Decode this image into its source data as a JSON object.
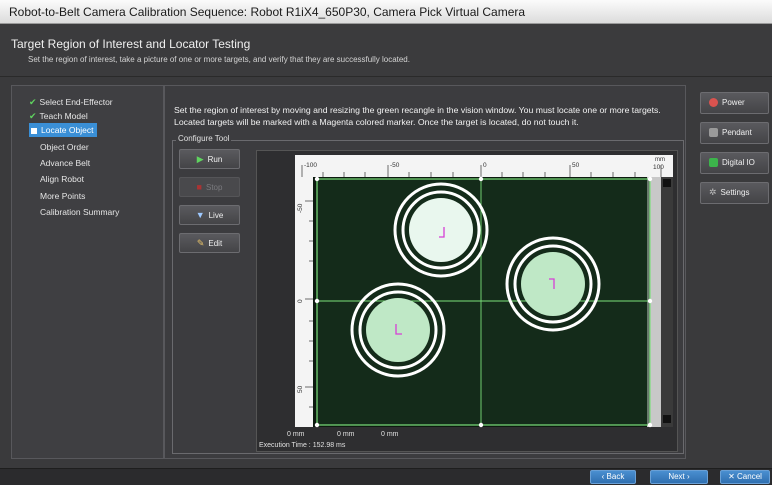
{
  "window": {
    "title": "Robot-to-Belt Camera Calibration Sequence: Robot R1iX4_650P30, Camera Pick Virtual Camera"
  },
  "header": {
    "title": "Target Region of Interest and Locator Testing",
    "subtitle": "Set the region of interest, take a picture of one or more targets, and verify that they are successfully located."
  },
  "steps": [
    {
      "label": "Select End-Effector",
      "done": true
    },
    {
      "label": "Teach Model",
      "done": true
    },
    {
      "label": "Locate Object",
      "done": false,
      "active": true
    },
    {
      "label": "Object Order",
      "done": false
    },
    {
      "label": "Advance Belt",
      "done": false
    },
    {
      "label": "Align Robot",
      "done": false
    },
    {
      "label": "More Points",
      "done": false
    },
    {
      "label": "Calibration Summary",
      "done": false
    }
  ],
  "instructions": "Set the region of interest by moving and resizing the green recangle in the vision window. You must locate one or more targets. Located targets will be marked with a Magenta colored marker. Once the target is located, do not touch it.",
  "configure_tool": {
    "label": "Configure Tool",
    "buttons": [
      {
        "label": "Run",
        "icon": "play-icon",
        "enabled": true
      },
      {
        "label": "Stop",
        "icon": "stop-icon",
        "enabled": false
      },
      {
        "label": "Live",
        "icon": "camera-icon",
        "enabled": true
      },
      {
        "label": "Edit",
        "icon": "edit-icon",
        "enabled": true
      }
    ]
  },
  "vision": {
    "top_ruler": [
      "-100",
      "-50",
      "0",
      "50",
      "100"
    ],
    "ruler_unit": "mm",
    "left_ruler": [
      "-50",
      "0",
      "50"
    ],
    "status_coords": [
      "0 mm",
      "0 mm",
      "0 mm"
    ],
    "execution_time": "Execution Time : 152.98 ms",
    "zoom_label": "100"
  },
  "right_buttons": [
    {
      "label": "Power",
      "icon": "power-icon",
      "color": "#d9534f"
    },
    {
      "label": "Pendant",
      "icon": "pendant-icon",
      "color": "#9a9a9a"
    },
    {
      "label": "Digital IO",
      "icon": "digital-io-icon",
      "color": "#3cb44b"
    },
    {
      "label": "Settings",
      "icon": "settings-icon",
      "color": "#bdbdbd"
    }
  ],
  "nav": {
    "back": "Back",
    "next": "Next",
    "cancel": "Cancel"
  },
  "colors": {
    "roi": "#7be07b",
    "marker": "#d63fd6",
    "accent": "#3a8fd6"
  }
}
